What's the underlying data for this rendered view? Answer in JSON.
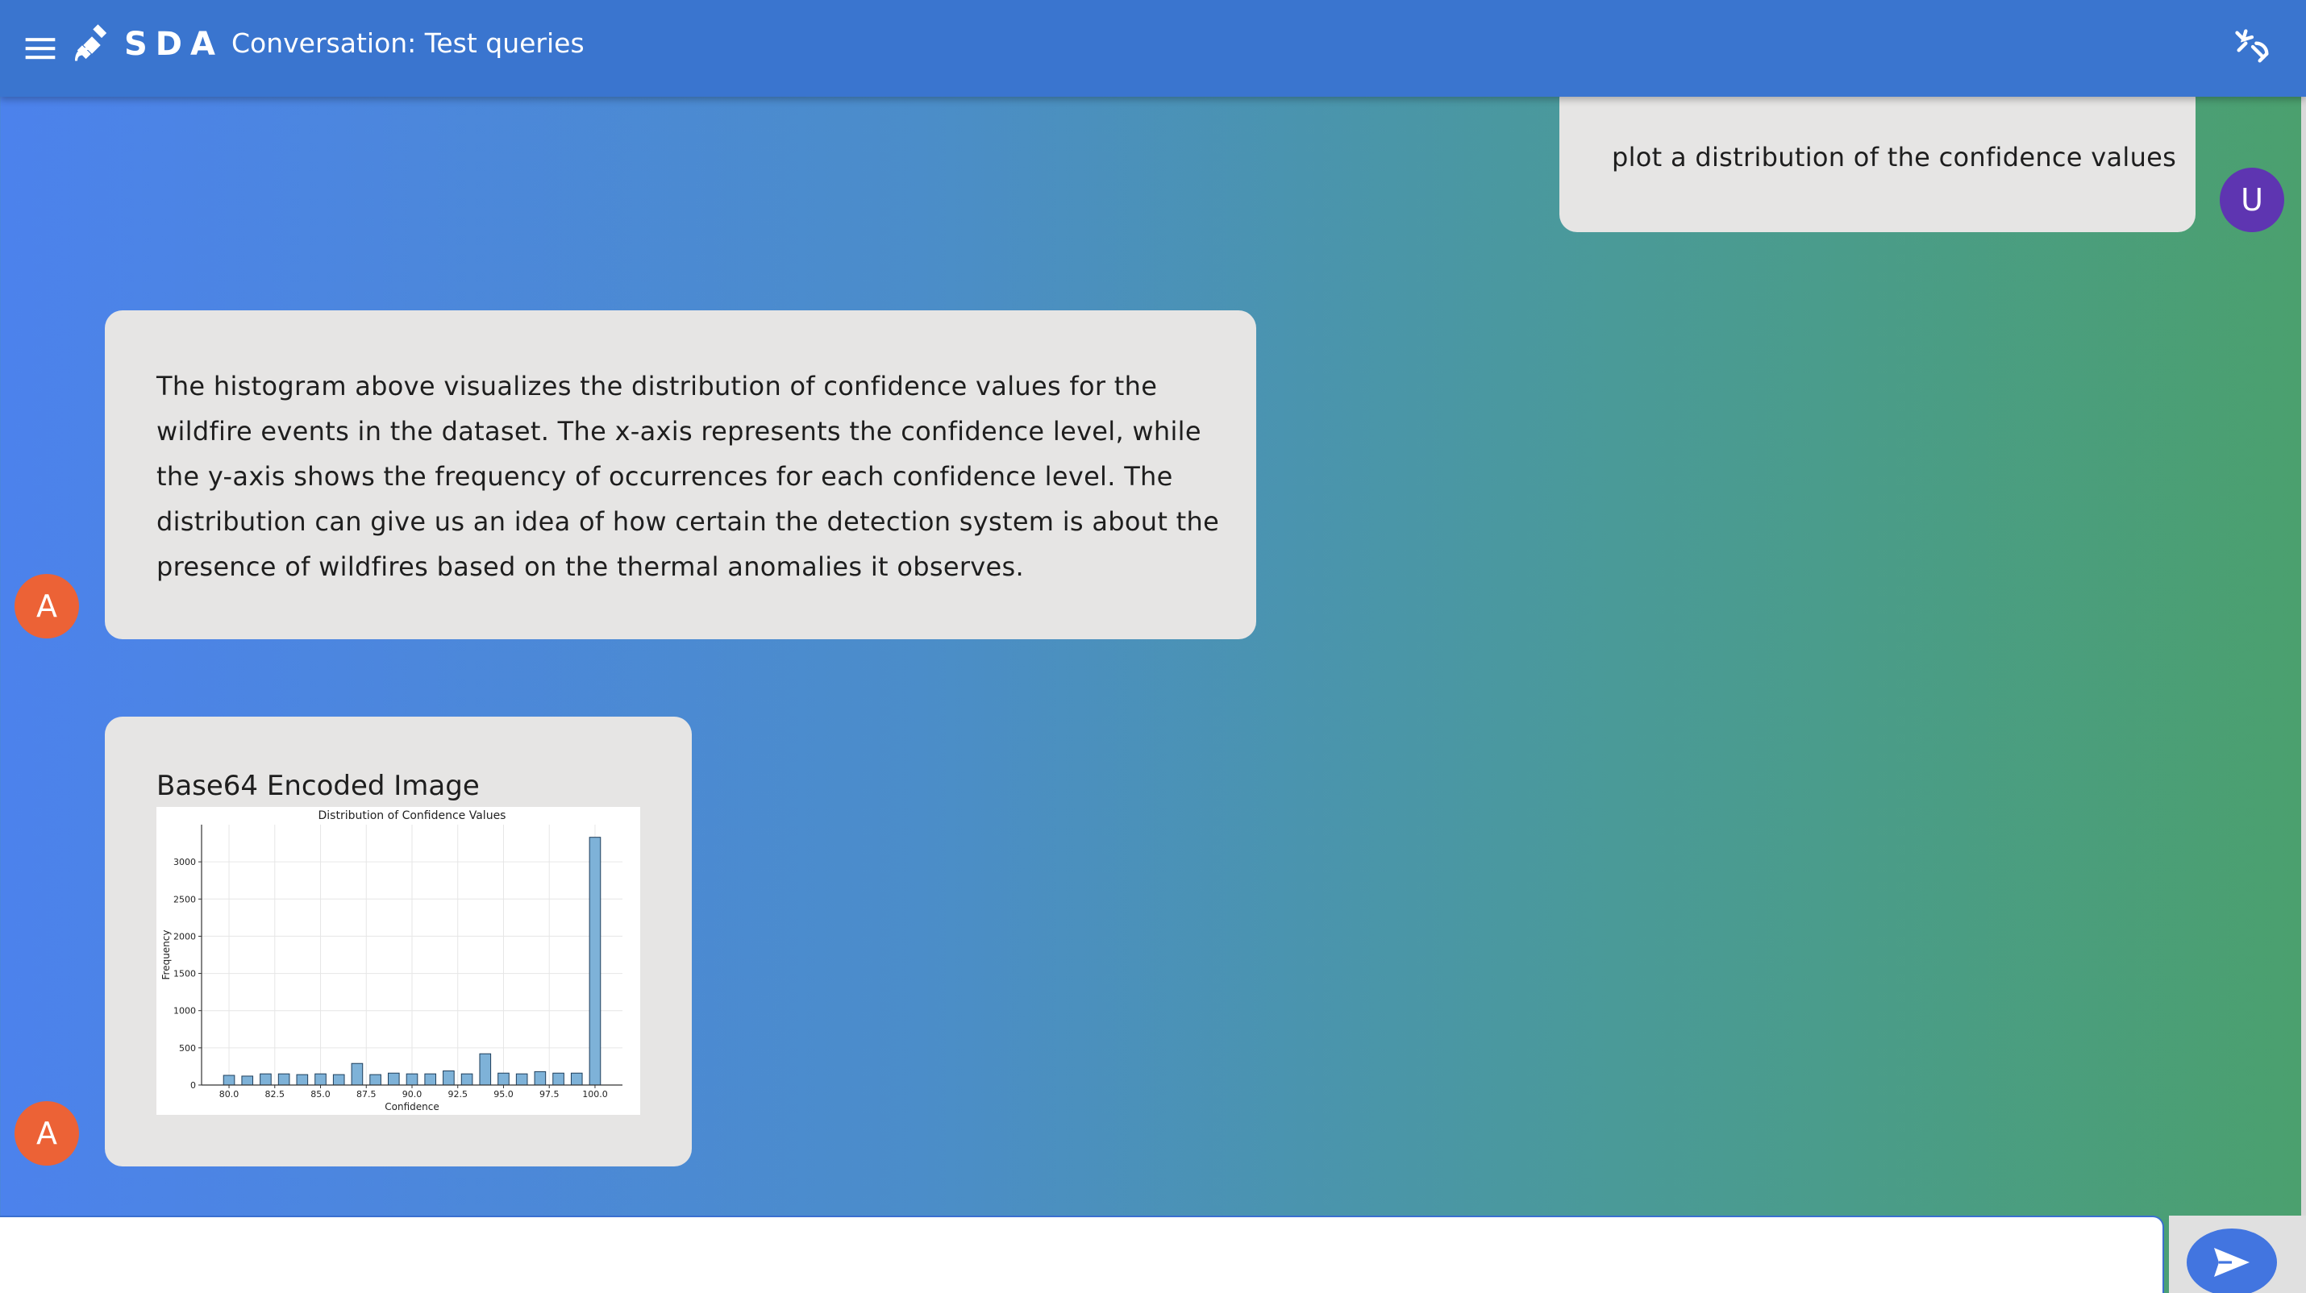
{
  "header": {
    "logo_text": "SDA",
    "conversation_title": "Conversation: Test queries",
    "menu_icon": "hamburger-menu-icon",
    "logo_icon": "satellite-icon",
    "api_icon": "api-icon"
  },
  "colors": {
    "topbar": "#3a75cf",
    "user_avatar": "#5e35b1",
    "assistant_avatar": "#ec6236",
    "bubble": "#e6e5e4",
    "send_button": "#4275e0",
    "histogram_bar": "#7eb2d8"
  },
  "messages": [
    {
      "role": "user",
      "avatar_letter": "U",
      "text": "plot a distribution of the confidence values"
    },
    {
      "role": "assistant",
      "avatar_letter": "A",
      "text": "The histogram above visualizes the distribution of confidence values for the wildfire events in the dataset. The x-axis represents the confidence level, while the y-axis shows the frequency of occurrences for each confidence level. The distribution can give us an idea of how certain the detection system is about the presence of wildfires based on the thermal anomalies it observes."
    },
    {
      "role": "assistant",
      "avatar_letter": "A",
      "caption": "Base64 Encoded Image"
    }
  ],
  "composer": {
    "value": "",
    "send_icon": "send-icon"
  },
  "chart_data": {
    "type": "bar",
    "title": "Distribution of Confidence Values",
    "xlabel": "Confidence",
    "ylabel": "Frequency",
    "xlim": [
      78.5,
      101.5
    ],
    "ylim": [
      0,
      3500
    ],
    "xticks": [
      "80.0",
      "82.5",
      "85.0",
      "87.5",
      "90.0",
      "92.5",
      "95.0",
      "97.5",
      "100.0"
    ],
    "yticks": [
      "0",
      "500",
      "1000",
      "1500",
      "2000",
      "2500",
      "3000"
    ],
    "x": [
      80,
      81,
      82,
      83,
      84,
      85,
      86,
      87,
      88,
      89,
      90,
      91,
      92,
      93,
      94,
      95,
      96,
      97,
      98,
      99,
      100
    ],
    "values": [
      130,
      120,
      150,
      150,
      140,
      150,
      140,
      290,
      140,
      160,
      150,
      150,
      190,
      150,
      420,
      160,
      150,
      180,
      160,
      160,
      3330
    ],
    "grid": true
  }
}
